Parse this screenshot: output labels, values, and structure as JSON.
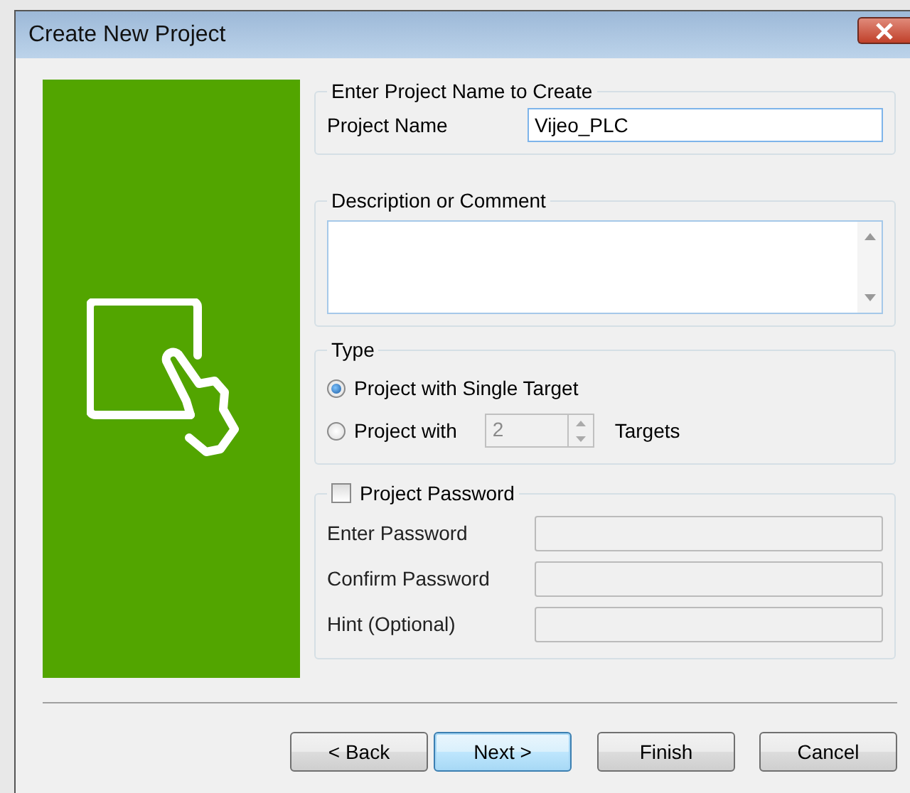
{
  "window": {
    "title": "Create New Project"
  },
  "project_name_group": {
    "title": "Enter Project Name to Create",
    "label": "Project Name",
    "value": "Vijeo_PLC"
  },
  "description_group": {
    "title": "Description or Comment"
  },
  "type_group": {
    "title": "Type",
    "options": [
      {
        "kind": "plain",
        "label": "Project with Single Target",
        "selected": true
      },
      {
        "kind": "count",
        "label": "Project with",
        "selected": false,
        "count": "2",
        "count_disabled": true,
        "suffix": "Targets"
      }
    ]
  },
  "password_group": {
    "checkbox_label": "Project Password",
    "checked": false,
    "fields": [
      {
        "label": "Enter Password",
        "disabled": true
      },
      {
        "label": "Confirm Password",
        "disabled": true
      },
      {
        "label": "Hint (Optional)",
        "disabled": true
      }
    ]
  },
  "buttons": [
    {
      "label": "< Back",
      "default": false
    },
    {
      "label": "Next >",
      "default": true
    },
    {
      "label": "Finish",
      "default": false
    },
    {
      "label": "Cancel",
      "default": false
    }
  ]
}
